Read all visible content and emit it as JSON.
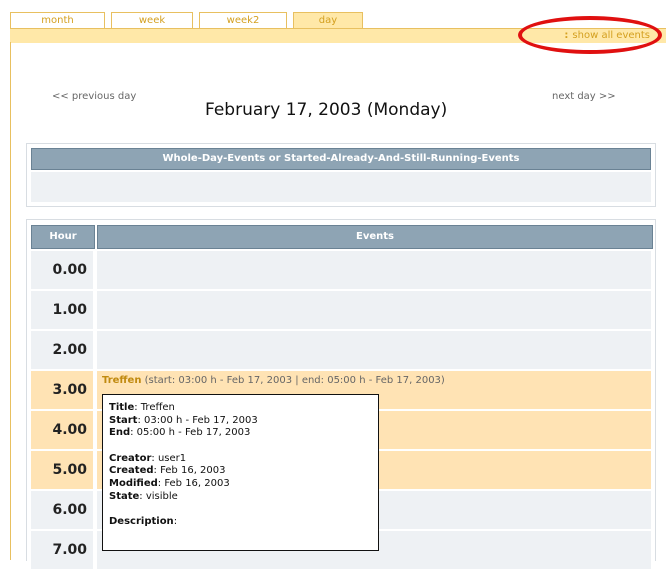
{
  "tabs": [
    {
      "label": "month"
    },
    {
      "label": "week"
    },
    {
      "label": "week2"
    },
    {
      "label": "day",
      "active": true
    }
  ],
  "toolbar": {
    "show_all": "show all events",
    "marker": ":"
  },
  "nav": {
    "prev": "<< previous day",
    "next": "next day >>",
    "date_title": "February 17, 2003 (Monday)"
  },
  "whole_day": {
    "header": "Whole-Day-Events or Started-Already-And-Still-Running-Events"
  },
  "table": {
    "col_hour": "Hour",
    "col_events": "Events",
    "hours": [
      "0.00",
      "1.00",
      "2.00",
      "3.00",
      "4.00",
      "5.00",
      "6.00",
      "7.00"
    ],
    "busy_hours": [
      "3.00",
      "4.00",
      "5.00"
    ]
  },
  "event": {
    "title": "Treffen",
    "details": " (start: 03:00 h - Feb 17, 2003 | end: 05:00 h - Feb 17, 2003)"
  },
  "tooltip": {
    "title_label": "Title",
    "title_value": ": Treffen",
    "start_label": "Start",
    "start_value": ": 03:00 h - Feb 17, 2003",
    "end_label": "End",
    "end_value": ": 05:00 h - Feb 17, 2003",
    "creator_label": "Creator",
    "creator_value": ": user1",
    "created_label": "Created",
    "created_value": ": Feb 16, 2003",
    "modified_label": "Modified",
    "modified_value": ": Feb 16, 2003",
    "state_label": "State",
    "state_value": ": visible",
    "description_label": "Description",
    "description_value": ":"
  },
  "colors": {
    "accent": "#d4a020",
    "header": "#8ea4b4",
    "busy": "#ffe3b4",
    "highlight_ring": "#e01010"
  }
}
